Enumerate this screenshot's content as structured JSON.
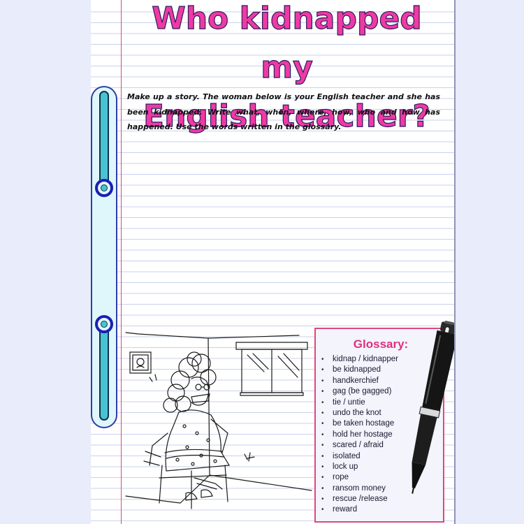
{
  "worksheet": {
    "title_line1": "Who kidnapped my",
    "title_line2": "English teacher?",
    "instructions": "Make up a story. The woman below is your English teacher and she has been kidnapped. Write what, when, where, how, who and how has happened. Use the words written in the glossary.",
    "illustration_icon": "tied-up-teacher-illustration",
    "pen_icon": "pen-icon"
  },
  "glossary": {
    "title": "Glossary:",
    "items": [
      "kidnap / kidnapper",
      "be kidnapped",
      "handkerchief",
      "gag (be gagged)",
      "tie / untie",
      "undo the knot",
      "be taken hostage",
      "hold her hostage",
      "scared / afraid",
      "isolated",
      "lock up",
      "rope",
      "ransom money",
      "rescue /release",
      "reward"
    ]
  },
  "colors": {
    "title": "#ef3aa3",
    "glossary_border": "#e0487a",
    "binder_ring": "#1c1fb4",
    "binder_bar": "#49c3d2",
    "page_background": "#e9ecfa"
  }
}
